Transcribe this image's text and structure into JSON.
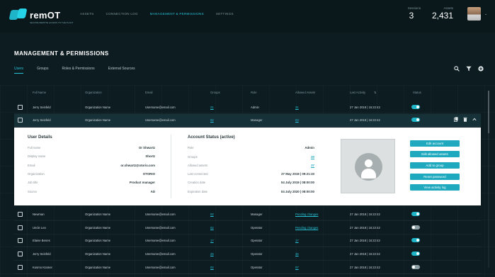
{
  "app": {
    "logo_text": "remOT",
    "logo_tagline": "SECURE REMOTE ACCESS TO THE PLANT",
    "nav": [
      "ASSETS",
      "CONNECTION LOG",
      "MANAGEMENT & PERMISSIONS",
      "SETTINGS"
    ],
    "active_nav": 2,
    "stats": [
      {
        "label": "Sessions",
        "value": "3"
      },
      {
        "label": "Assets",
        "value": "2,431"
      }
    ],
    "avatar_caret": "⌄"
  },
  "page": {
    "title": "MANAGEMENT & PERMISSIONS",
    "tabs": [
      "Users",
      "Groups",
      "Roles & Permissions",
      "External Sources"
    ],
    "active_tab": 0,
    "tools": {
      "search": "search-icon",
      "filter": "filter-icon",
      "add": "plus-circle-icon"
    }
  },
  "table": {
    "columns": [
      "Full Name",
      "Organization",
      "Email",
      "Groups",
      "Role",
      "Allowed Assets",
      "Last Activity",
      "Status"
    ],
    "sort_indicator": "⇅",
    "rows_top": [
      {
        "name": "Jerry Seinfeld",
        "org": "Organization Name",
        "email": "Username@email.com",
        "groups": "21",
        "role": "Admin",
        "assets": "31",
        "activity": "27 Jan 2018 | 16:22:42",
        "status": "on"
      },
      {
        "name": "Jerry Seinfeld",
        "org": "Organization Name",
        "email": "Username@email.com",
        "groups": "02",
        "role": "Manager",
        "assets": "03",
        "activity": "27 Jan 2018 | 16:22:42",
        "status": "on"
      }
    ],
    "rows_bottom": [
      {
        "name": "Newman",
        "org": "Organization Name",
        "email": "Username@email.com",
        "groups": "02",
        "role": "Manager",
        "assets": "Pending changes",
        "activity": "27 Jan 2018 | 16:22:42",
        "status": "on"
      },
      {
        "name": "Uncle Leo",
        "org": "Organization Name",
        "email": "Username@email.com",
        "groups": "02",
        "role": "Operator",
        "assets": "Pending changes",
        "activity": "27 Jan 2018 | 16:22:42",
        "status": "off"
      },
      {
        "name": "Elaine Benes",
        "org": "Organization Name",
        "email": "Username@email.com",
        "groups": "17",
        "role": "Operator",
        "assets": "17",
        "activity": "27 Jan 2018 | 16:22:42",
        "status": "on"
      },
      {
        "name": "Jerry Seinfeld",
        "org": "Organization Name",
        "email": "Username@email.com",
        "groups": "26",
        "role": "Operator",
        "assets": "36",
        "activity": "27 Jan 2018 | 16:22:42",
        "status": "on"
      },
      {
        "name": "Kosmo Kramer",
        "org": "Organization Name",
        "email": "Username@email.com",
        "groups": "02",
        "role": "Operator",
        "assets": "07",
        "activity": "27 Jan 2018 | 16:22:42",
        "status": "off"
      }
    ]
  },
  "details": {
    "user_title": "User Details",
    "account_title": "Account Status (active)",
    "user_fields": [
      {
        "label": "Full name",
        "value": "Or Shwartz"
      },
      {
        "label": "Display name",
        "value": "Shortz"
      },
      {
        "label": "Email",
        "value": "or.shwartz@otorio.com"
      },
      {
        "label": "Organization",
        "value": "OTORIO"
      },
      {
        "label": "Job title",
        "value": "Product manager"
      },
      {
        "label": "Source",
        "value": "AD"
      }
    ],
    "account_fields": [
      {
        "label": "Role",
        "value": "Admin"
      },
      {
        "label": "Groups",
        "value": "20"
      },
      {
        "label": "Allowed assets",
        "value": "37"
      },
      {
        "label": "Last connected",
        "value": "27 May 2019 | 09:21:33"
      },
      {
        "label": "Creation date",
        "value": "04 July 2019 | 08:00:00"
      },
      {
        "label": "Expiration date",
        "value": "04 July 2020 | 08:00:00"
      }
    ],
    "actions": [
      "Edit account",
      "Edit allowed assets",
      "Add to group",
      "Reset password",
      "View activity log"
    ]
  },
  "colors": {
    "accent": "#27c2d6",
    "background": "#0c1c21",
    "button": "#1fa9bf"
  }
}
